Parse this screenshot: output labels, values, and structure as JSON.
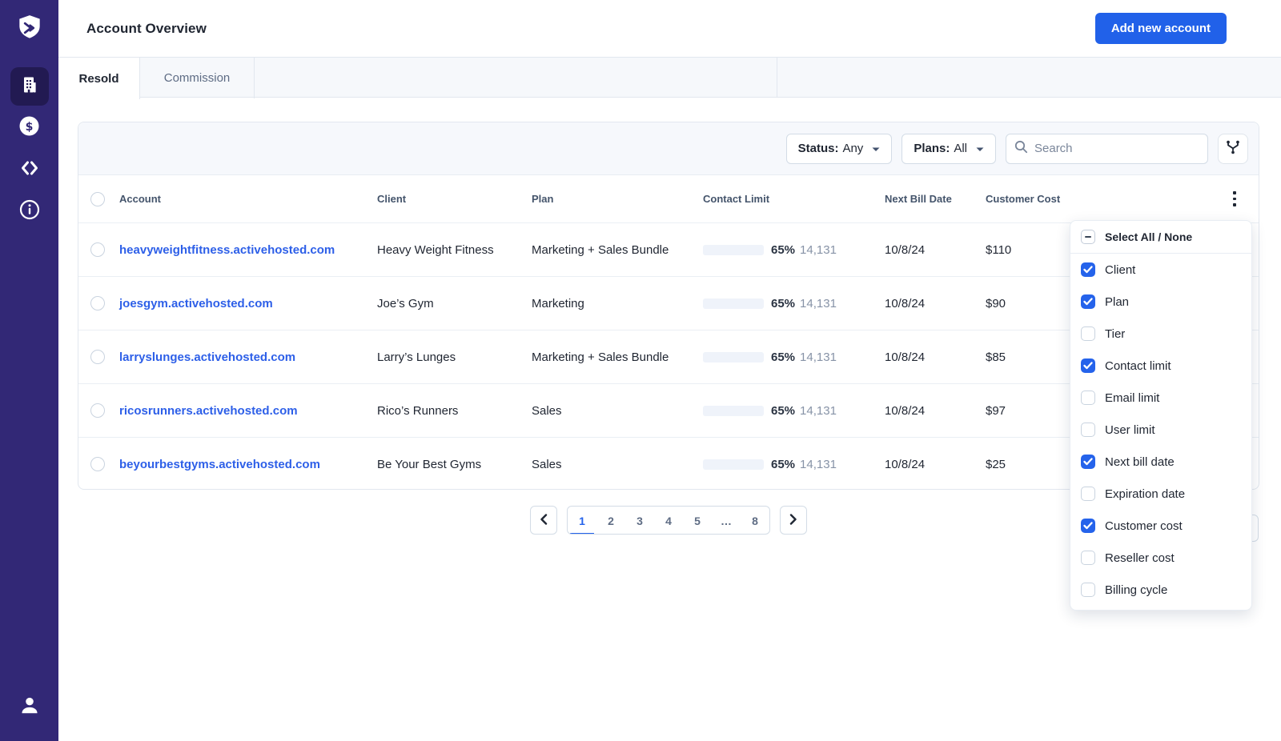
{
  "colors": {
    "accent_blue": "#2161E9",
    "checkbox_blue": "#2563EB",
    "link_blue": "#2D5FE8",
    "sidebar_purple": "#322876",
    "sidebar_active_purple": "#221A52",
    "progress_green": "#5AA268",
    "muted_text": "#5E6C84"
  },
  "sidebar": {
    "logo_icon": "shield-logo",
    "items": [
      {
        "icon": "building-icon",
        "active": true
      },
      {
        "icon": "dollar-icon",
        "active": false
      },
      {
        "icon": "code-icon",
        "active": false
      },
      {
        "icon": "info-icon",
        "active": false
      }
    ],
    "footer_icon": "user-icon"
  },
  "header": {
    "title": "Account Overview",
    "add_button_label": "Add new account"
  },
  "tabs": [
    {
      "label": "Resold",
      "active": true
    },
    {
      "label": "Commission",
      "active": false
    }
  ],
  "filters": {
    "status_label": "Status:",
    "status_value": "Any",
    "plans_label": "Plans:",
    "plans_value": "All",
    "search_placeholder": "Search",
    "filter_icon": "funnel-icon"
  },
  "table": {
    "columns": [
      "Account",
      "Client",
      "Plan",
      "Contact Limit",
      "Next Bill Date",
      "Customer Cost"
    ],
    "rows": [
      {
        "account": "heavyweightfitness.activehosted.com",
        "client": "Heavy Weight Fitness",
        "plan": "Marketing + Sales Bundle",
        "contact_pct": 65,
        "contact_pct_label": "65%",
        "contact_count": "14,131",
        "next_bill_date": "10/8/24",
        "customer_cost": "$110"
      },
      {
        "account": "joesgym.activehosted.com",
        "client": "Joe’s Gym",
        "plan": "Marketing",
        "contact_pct": 65,
        "contact_pct_label": "65%",
        "contact_count": "14,131",
        "next_bill_date": "10/8/24",
        "customer_cost": "$90"
      },
      {
        "account": "larryslunges.activehosted.com",
        "client": "Larry’s Lunges",
        "plan": "Marketing + Sales Bundle",
        "contact_pct": 65,
        "contact_pct_label": "65%",
        "contact_count": "14,131",
        "next_bill_date": "10/8/24",
        "customer_cost": "$85"
      },
      {
        "account": "ricosrunners.activehosted.com",
        "client": "Rico’s Runners",
        "plan": "Sales",
        "contact_pct": 65,
        "contact_pct_label": "65%",
        "contact_count": "14,131",
        "next_bill_date": "10/8/24",
        "customer_cost": "$97"
      },
      {
        "account": "beyourbestgyms.activehosted.com",
        "client": "Be Your Best Gyms",
        "plan": "Sales",
        "contact_pct": 65,
        "contact_pct_label": "65%",
        "contact_count": "14,131",
        "next_bill_date": "10/8/24",
        "customer_cost": "$25"
      }
    ]
  },
  "pagination": {
    "prev_icon": "chevron-left-icon",
    "next_icon": "chevron-right-icon",
    "pages": [
      "1",
      "2",
      "3",
      "4",
      "5",
      "…",
      "8"
    ],
    "active_page": "1"
  },
  "column_menu": {
    "select_all": {
      "label": "Select All / None",
      "state": "indeterminate"
    },
    "items": [
      {
        "label": "Client",
        "checked": true
      },
      {
        "label": "Plan",
        "checked": true
      },
      {
        "label": "Tier",
        "checked": false
      },
      {
        "label": "Contact limit",
        "checked": true
      },
      {
        "label": "Email limit",
        "checked": false
      },
      {
        "label": "User limit",
        "checked": false
      },
      {
        "label": "Next bill date",
        "checked": true
      },
      {
        "label": "Expiration date",
        "checked": false
      },
      {
        "label": "Customer cost",
        "checked": true
      },
      {
        "label": "Reseller cost",
        "checked": false
      },
      {
        "label": "Billing cycle",
        "checked": false
      }
    ]
  }
}
